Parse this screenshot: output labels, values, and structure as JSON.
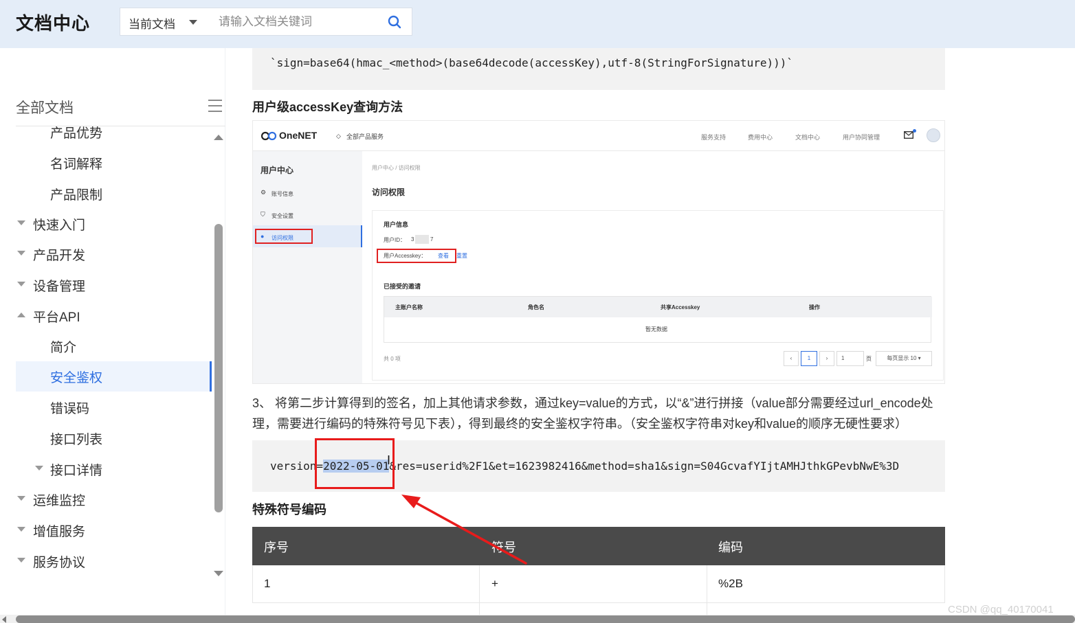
{
  "header": {
    "logo": "文档中心",
    "scope_label": "当前文档",
    "search_placeholder": "请输入文档关键词"
  },
  "sidebar": {
    "title": "全部文档",
    "items": [
      {
        "label": "产品优势",
        "level": 2
      },
      {
        "label": "名词解释",
        "level": 2
      },
      {
        "label": "产品限制",
        "level": 2
      },
      {
        "label": "快速入门",
        "level": 1,
        "state": "collapsed"
      },
      {
        "label": "产品开发",
        "level": 1,
        "state": "collapsed"
      },
      {
        "label": "设备管理",
        "level": 1,
        "state": "collapsed"
      },
      {
        "label": "平台API",
        "level": 1,
        "state": "expanded"
      },
      {
        "label": "简介",
        "level": 2
      },
      {
        "label": "安全鉴权",
        "level": 2,
        "active": true
      },
      {
        "label": "错误码",
        "level": 2
      },
      {
        "label": "接口列表",
        "level": 2
      },
      {
        "label": "接口详情",
        "level": 2,
        "state": "collapsed"
      },
      {
        "label": "运维监控",
        "level": 1,
        "state": "collapsed"
      },
      {
        "label": "增值服务",
        "level": 1,
        "state": "collapsed"
      },
      {
        "label": "服务协议",
        "level": 1,
        "state": "collapsed"
      }
    ]
  },
  "content": {
    "code_sign": "`sign=base64(hmac_<method>(base64decode(accessKey),utf-8(StringForSignature)))`",
    "section_user_key": "用户级accessKey查询方法",
    "screenshot": {
      "brand": "OneNET",
      "all_products": "全部产品服务",
      "nav": [
        "服务支持",
        "费用中心",
        "文档中心",
        "用户协同管理"
      ],
      "side_title": "用户中心",
      "side_items": [
        "账号信息",
        "安全设置",
        "访问权限"
      ],
      "breadcrumb": "用户中心 / 访问权限",
      "page_title": "访问权限",
      "user_info_title": "用户信息",
      "user_id_label": "用户ID：",
      "user_id_prefix": "3",
      "user_id_suffix": "7",
      "accesskey_label": "用户Accesskey：",
      "view_link": "查看",
      "reset_link": "重置",
      "invites_title": "已接受的邀请",
      "invite_columns": [
        "主账户名称",
        "角色名",
        "共享Accesskey",
        "操作"
      ],
      "no_data": "暂无数据",
      "total": "共 0 项",
      "pager_current": "1",
      "pager_jump": "1",
      "pager_page_unit": "页",
      "pager_size": "每页显示 10 ▾"
    },
    "step3_line1": "3、 将第二步计算得到的签名，加上其他请求参数，通过key=value的方式，以“&”进行拼接（value部分需要经过url_encode处",
    "step3_line2": "理，需要进行编码的特殊符号见下表），得到最终的安全鉴权字符串。（安全鉴权字符串对key和value的顺序无硬性要求）",
    "code_version_prefix": "version=",
    "code_version_selected": "2022-05-01",
    "code_version_rest": "&res=userid%2F1&et=1623982416&method=sha1&sign=S04GcvafYIjtAMHJthkGPevbNwE%3D",
    "section_special": "特殊符号编码",
    "table": {
      "columns": [
        "序号",
        "符号",
        "编码"
      ],
      "rows": [
        [
          "1",
          "+",
          "%2B"
        ]
      ]
    }
  },
  "watermark": "CSDN @qq_40170041",
  "colors": {
    "accent": "#2f6fe0",
    "annotation_red": "#e81b1b",
    "header_bg": "#e4edf8",
    "table_head": "#4a4a4a"
  }
}
